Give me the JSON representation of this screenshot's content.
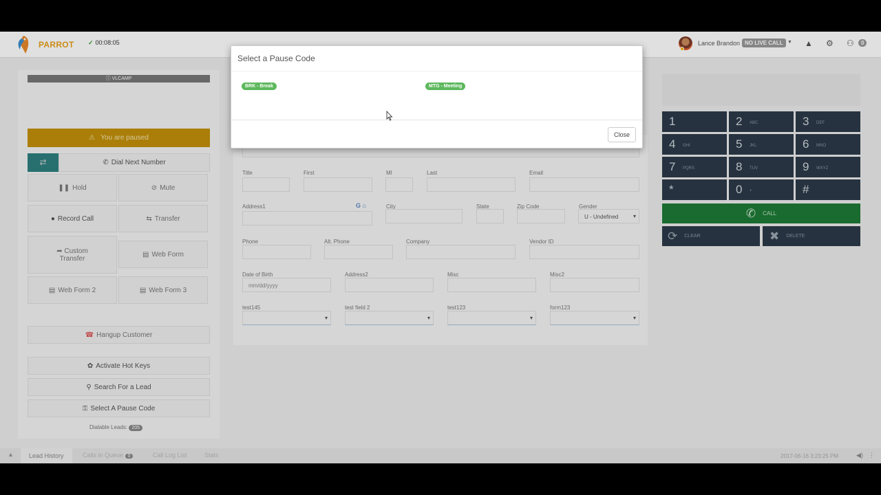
{
  "header": {
    "brand": "PARROT",
    "timer": "00:08:05",
    "user_name": "Lance Brandon",
    "call_status": "NO LIVE CALL",
    "notifications_count": "0"
  },
  "left_panel": {
    "campaign_label": "VLCAMP",
    "paused_text": "You are paused",
    "dial_next": "Dial Next Number",
    "hold": "Hold",
    "mute": "Mute",
    "record_call": "Record Call",
    "transfer": "Transfer",
    "custom_transfer_line1": "Custom",
    "custom_transfer_line2": "Transfer",
    "web_form": "Web Form",
    "web_form_2": "Web Form 2",
    "web_form_3": "Web Form 3",
    "hangup": "Hangup Customer",
    "hot_keys": "Activate Hot Keys",
    "search_lead": "Search For a Lead",
    "pause_code": "Select A Pause Code",
    "dialable_label": "Dialable Leads:",
    "dialable_count": "205"
  },
  "form": {
    "title": "Title",
    "first": "First",
    "mi": "MI",
    "last": "Last",
    "email": "Email",
    "address1": "Address1",
    "city": "City",
    "state": "State",
    "zip": "Zip Code",
    "gender": "Gender",
    "gender_value": "U - Undefined",
    "phone": "Phone",
    "alt_phone": "Alt. Phone",
    "company": "Company",
    "vendor_id": "Vendor ID",
    "dob": "Date of Birth",
    "dob_placeholder": "mm/dd/yyyy",
    "address2": "Address2",
    "misc": "Misc",
    "misc2": "Misc2",
    "test145": "test145",
    "test_field_2": "test field 2",
    "test123": "test123",
    "form123": "form123"
  },
  "keypad": {
    "keys": [
      {
        "num": "1",
        "sub": ""
      },
      {
        "num": "2",
        "sub": "ABC"
      },
      {
        "num": "3",
        "sub": "DEF"
      },
      {
        "num": "4",
        "sub": "GHI"
      },
      {
        "num": "5",
        "sub": "JKL"
      },
      {
        "num": "6",
        "sub": "MNO"
      },
      {
        "num": "7",
        "sub": "PQRS"
      },
      {
        "num": "8",
        "sub": "TUV"
      },
      {
        "num": "9",
        "sub": "WXYZ"
      },
      {
        "num": "*",
        "sub": ""
      },
      {
        "num": "0",
        "sub": "+"
      },
      {
        "num": "#",
        "sub": ""
      }
    ],
    "call": "CALL",
    "clear": "CLEAR",
    "delete": "DELETE"
  },
  "bottom": {
    "tab_lead_history": "Lead History",
    "tab_calls_queue": "Calls in Queue",
    "calls_queue_count": "0",
    "tab_call_log": "Call Log List",
    "tab_stats": "Stats",
    "datetime": "2017-06-16 3:23:25 PM"
  },
  "modal": {
    "title": "Select a Pause Code",
    "code_1": "BRK - Break",
    "code_2": "MTG - Meeting",
    "close": "Close"
  }
}
